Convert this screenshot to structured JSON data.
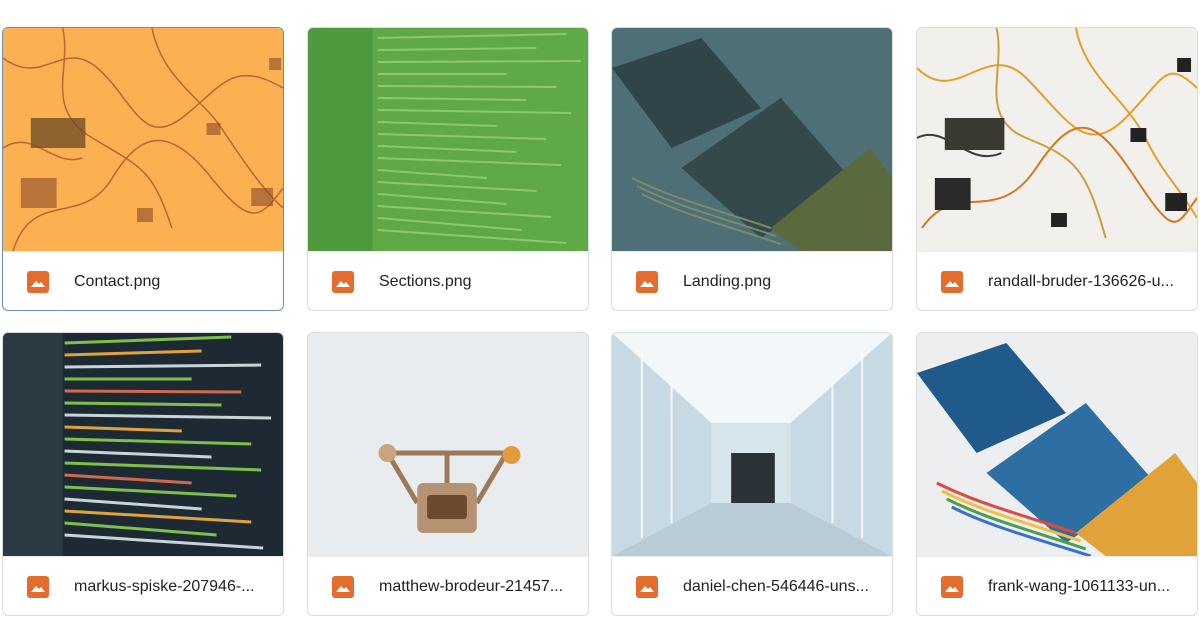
{
  "files": [
    {
      "name": "Contact.png",
      "selected": true
    },
    {
      "name": "Sections.png",
      "selected": false
    },
    {
      "name": "Landing.png",
      "selected": false
    },
    {
      "name": "randall-bruder-136626-u...",
      "selected": false
    },
    {
      "name": "markus-spiske-207946-...",
      "selected": false
    },
    {
      "name": "matthew-brodeur-21457...",
      "selected": false
    },
    {
      "name": "daniel-chen-546446-uns...",
      "selected": false
    },
    {
      "name": "frank-wang-1061133-un...",
      "selected": false
    }
  ],
  "file_icon": "image-file-icon",
  "colors": {
    "icon_accent": "#e26d2c",
    "selected_border": "#6a8fb5",
    "card_border": "#dadce0"
  }
}
